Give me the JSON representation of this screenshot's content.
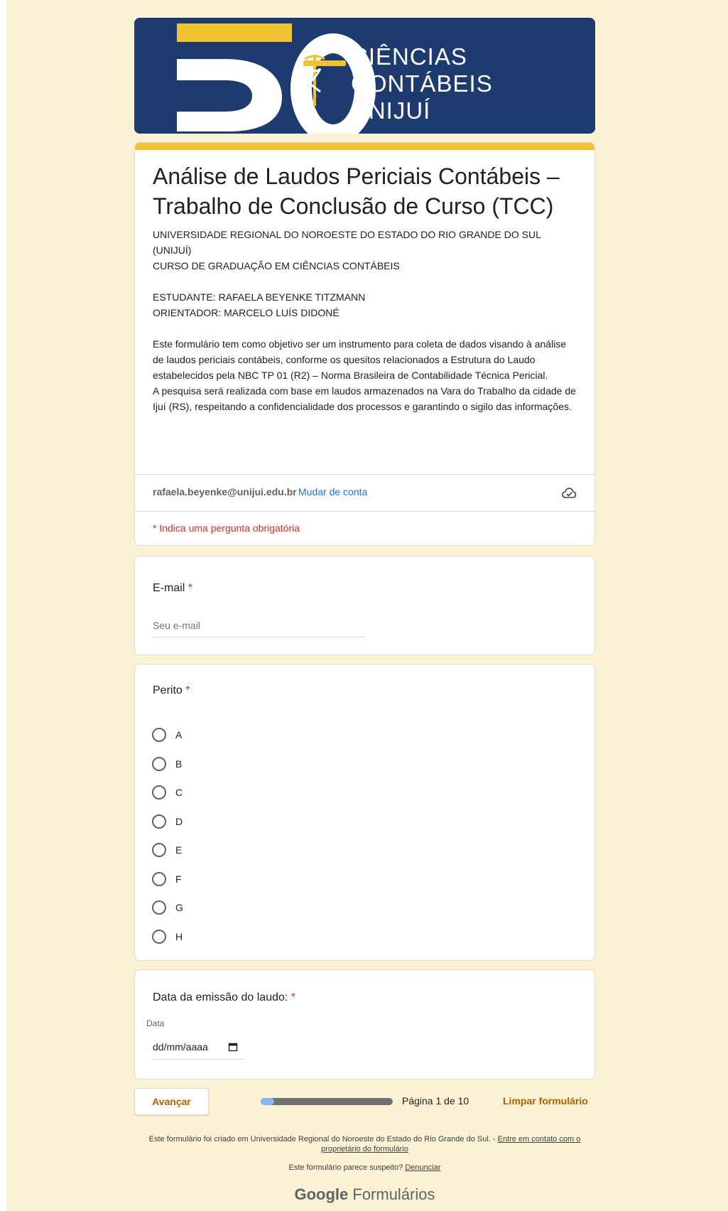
{
  "banner": {
    "number": "50",
    "emblem_text": "ANOS",
    "lines": [
      "CIÊNCIAS",
      "CONTÁBEIS",
      "UNIJUÍ"
    ],
    "colors": {
      "background": "#1e3b6f",
      "accent": "#f1c232",
      "white": "#ffffff"
    }
  },
  "form": {
    "title": "Análise de Laudos Periciais Contábeis – Trabalho de Conclusão de Curso (TCC)",
    "description": [
      "UNIVERSIDADE REGIONAL DO NOROESTE DO ESTADO DO RIO GRANDE DO SUL (UNIJUÍ)",
      "CURSO DE GRADUAÇÃO EM CIÊNCIAS CONTÁBEIS",
      "",
      "ESTUDANTE: RAFAELA BEYENKE TITZMANN",
      "ORIENTADOR: MARCELO LUÍS DIDONÉ",
      "",
      "Este formulário tem como objetivo ser um instrumento para coleta de dados visando à análise de laudos periciais contábeis, conforme os quesitos relacionados a Estrutura do Laudo estabelecidos pela NBC TP 01 (R2) – Norma Brasileira de Contabilidade Técnica Pericial.",
      "A pesquisa será realizada com base em laudos armazenados na Vara do Trabalho da cidade de Ijuí (RS), respeitando a confidencialidade dos processos e garantindo o sigilo das informações."
    ],
    "account_email": "rafaela.beyenke@unijui.edu.br",
    "switch_account": "Mudar de conta",
    "cloud_icon": "cloud-saved-icon",
    "required_note": "* Indica uma pergunta obrigatória"
  },
  "questions": {
    "email": {
      "label": "E-mail",
      "required_mark": "*",
      "placeholder": "Seu e-mail",
      "value": ""
    },
    "perito": {
      "label": "Perito",
      "required_mark": "*",
      "options": [
        "A",
        "B",
        "C",
        "D",
        "E",
        "F",
        "G",
        "H"
      ]
    },
    "date": {
      "label": "Data da emissão do laudo:",
      "required_mark": "*",
      "sub_label": "Data",
      "placeholder": "dd/mm/aaaa",
      "icon": "calendar-icon"
    }
  },
  "navigation": {
    "next_label": "Avançar",
    "page_label": "Página 1 de 10",
    "progress_fraction": 0.1,
    "clear_label": "Limpar formulário"
  },
  "footer": {
    "created_text": "Este formulário foi criado em Universidade Regional do Noroeste do Estado do Rio Grande do Sul. -",
    "contact_link": "Entre em contato com o proprietário do formulário",
    "suspicious_text": "Este formulário parece suspeito?",
    "report_link": "Denunciar",
    "brand_google": "Google",
    "brand_product": "Formulários"
  },
  "colors": {
    "page_background": "#fbf1d5",
    "theme_accent": "#f1c232",
    "action_text": "#b06000",
    "required": "#d93025",
    "link": "#1a73e8"
  }
}
